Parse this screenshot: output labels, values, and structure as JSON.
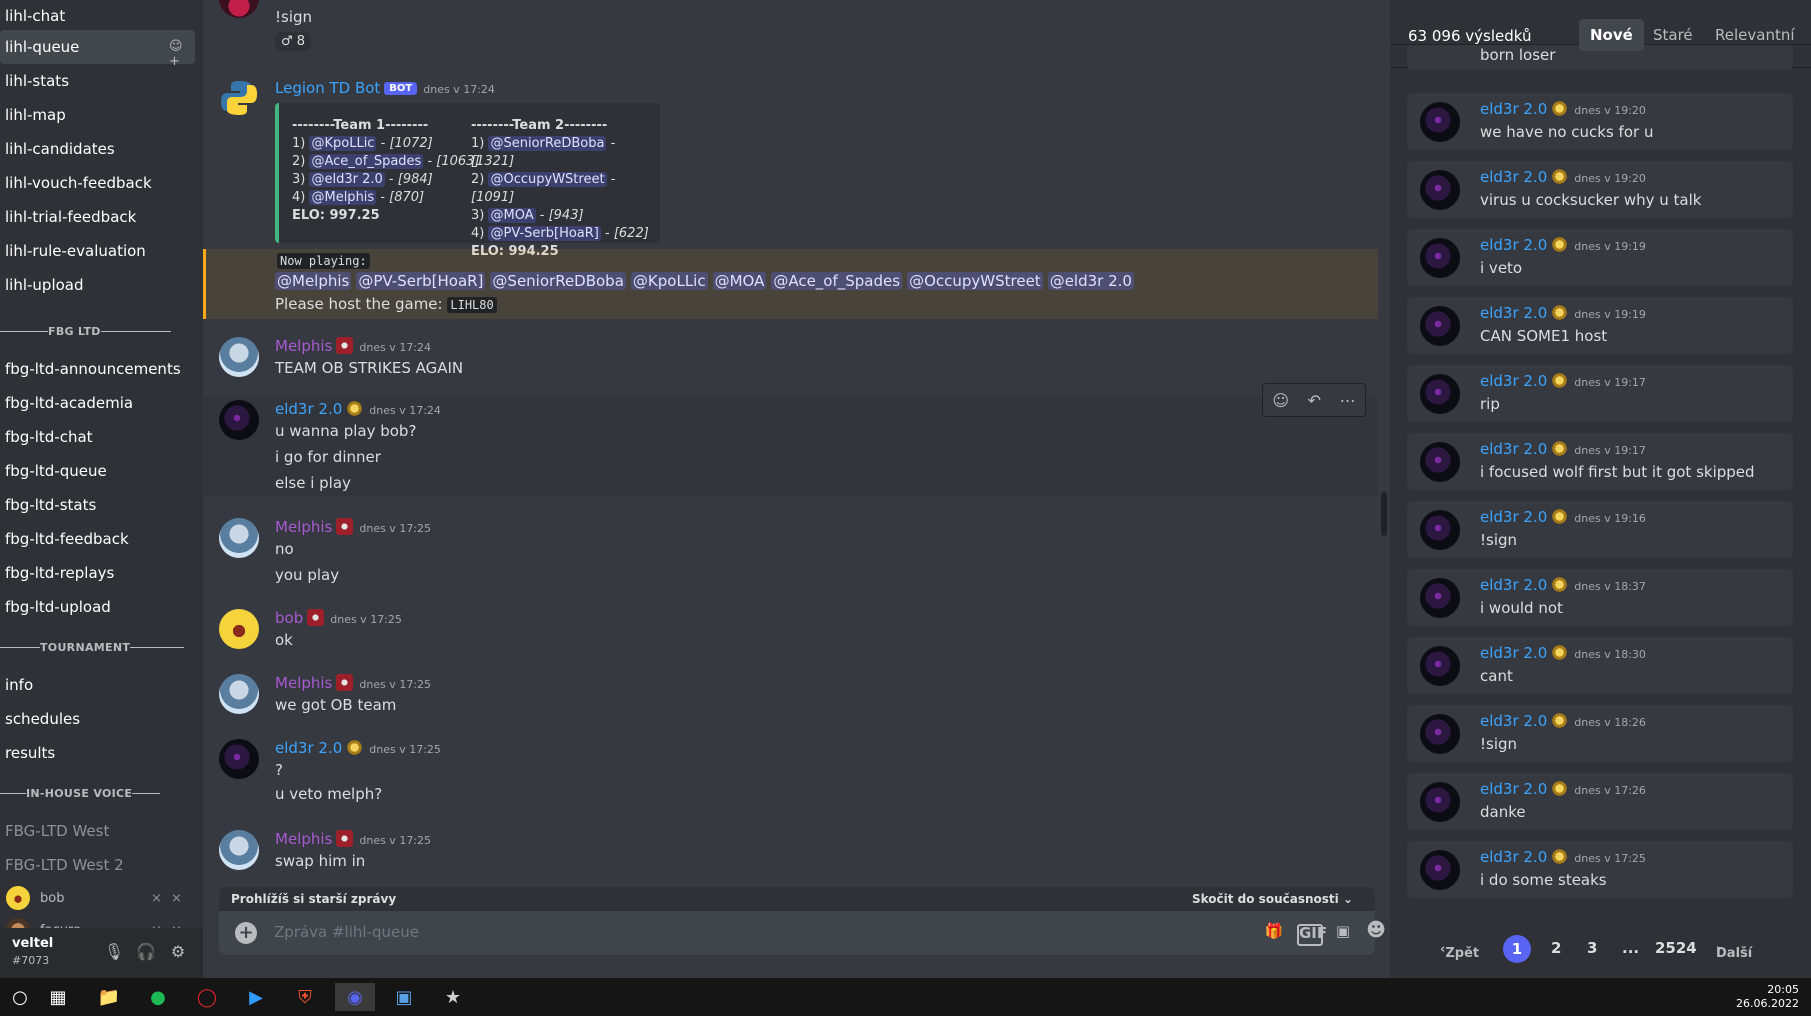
{
  "sidebar": {
    "channels_top": [
      "lihl-chat",
      "lihl-queue",
      "lihl-stats",
      "lihl-map",
      "lihl-candidates",
      "lihl-vouch-feedback",
      "lihl-trial-feedback",
      "lihl-rule-evaluation",
      "lihl-upload"
    ],
    "active_channel": "lihl-queue",
    "cat_fbg": "FBG LTD",
    "channels_fbg": [
      "fbg-ltd-announcements",
      "fbg-ltd-academia",
      "fbg-ltd-chat",
      "fbg-ltd-queue",
      "fbg-ltd-stats",
      "fbg-ltd-feedback",
      "fbg-ltd-replays",
      "fbg-ltd-upload"
    ],
    "cat_tournament": "TOURNAMENT",
    "channels_tournament": [
      "info",
      "schedules",
      "results"
    ],
    "cat_voice": "IN-HOUSE VOICE",
    "voice_channels": [
      "FBG-LTD West",
      "FBG-LTD West 2"
    ],
    "voice_users": [
      "bob",
      "facure"
    ]
  },
  "userbar": {
    "username": "veltel",
    "tag": "#7073"
  },
  "chat": {
    "top_line": "!sign",
    "reaction_count": "8",
    "bot": {
      "name": "Legion TD Bot",
      "tag": "BOT",
      "time": "dnes v 17:24",
      "team1_title": "--------Team 1--------",
      "team2_title": "--------Team 2--------",
      "team1": [
        {
          "n": "1)",
          "name": "@KpoLLic",
          "elo": "[1072]"
        },
        {
          "n": "2)",
          "name": "@Ace_of_Spades",
          "elo": "[1063]"
        },
        {
          "n": "3)",
          "name": "@eld3r 2.0",
          "elo": "[984]"
        },
        {
          "n": "4)",
          "name": "@Melphis",
          "elo": "[870]"
        }
      ],
      "team2": [
        {
          "n": "1)",
          "name": "@SeniorReDBoba",
          "elo": "[1321]"
        },
        {
          "n": "2)",
          "name": "@OccupyWStreet",
          "elo": "[1091]"
        },
        {
          "n": "3)",
          "name": "@MOA",
          "elo": "[943]"
        },
        {
          "n": "4)",
          "name": "@PV-Serb[HoaR]",
          "elo": "[622]"
        }
      ],
      "team1_elo": "ELO: 997.25",
      "team2_elo": "ELO: 994.25",
      "now_playing": "Now playing:",
      "mentions": [
        "@Melphis",
        "@PV-Serb[HoaR]",
        "@SeniorReDBoba",
        "@KpoLLic",
        "@MOA",
        "@Ace_of_Spades",
        "@OccupyWStreet",
        "@eld3r 2.0"
      ],
      "host_text": "Please host the game:",
      "host_code": "LIHL80"
    },
    "messages": [
      {
        "user": "Melphis",
        "time": "dnes v 17:24",
        "lines": [
          "TEAM OB STRIKES AGAIN"
        ]
      },
      {
        "user": "eld3r 2.0",
        "time": "dnes v 17:24",
        "lines": [
          "u wanna play bob?",
          "i go for dinner",
          "else i play"
        ]
      },
      {
        "user": "Melphis",
        "time": "dnes v 17:25",
        "lines": [
          "no",
          "you play"
        ]
      },
      {
        "user": "bob",
        "time": "dnes v 17:25",
        "lines": [
          "ok"
        ]
      },
      {
        "user": "Melphis",
        "time": "dnes v 17:25",
        "lines": [
          "we got OB team"
        ]
      },
      {
        "user": "eld3r 2.0",
        "time": "dnes v 17:25",
        "lines": [
          "?",
          "u veto melph?"
        ]
      },
      {
        "user": "Melphis",
        "time": "dnes v 17:25",
        "lines": [
          "swap him in"
        ]
      }
    ],
    "older_notice": "Prohlížíš si starší zprávy",
    "jump_present": "Skočit do současnosti",
    "composer_placeholder": "Zpráva #lihl-queue"
  },
  "search": {
    "count": "63 096 výsledků",
    "tabs": [
      "Nové",
      "Staré",
      "Relevantní"
    ],
    "active_tab": "Nové",
    "partial_top": "born loser",
    "results": [
      {
        "user": "eld3r 2.0",
        "time": "dnes v 19:20",
        "text": "we have no cucks for u"
      },
      {
        "user": "eld3r 2.0",
        "time": "dnes v 19:20",
        "text": "virus u cocksucker why u talk"
      },
      {
        "user": "eld3r 2.0",
        "time": "dnes v 19:19",
        "text": "i veto"
      },
      {
        "user": "eld3r 2.0",
        "time": "dnes v 19:19",
        "text": "CAN SOME1 host"
      },
      {
        "user": "eld3r 2.0",
        "time": "dnes v 19:17",
        "text": "rip"
      },
      {
        "user": "eld3r 2.0",
        "time": "dnes v 19:17",
        "text": "i focused wolf first but it got skipped"
      },
      {
        "user": "eld3r 2.0",
        "time": "dnes v 19:16",
        "text": "!sign"
      },
      {
        "user": "eld3r 2.0",
        "time": "dnes v 18:37",
        "text": "i would not"
      },
      {
        "user": "eld3r 2.0",
        "time": "dnes v 18:30",
        "text": "cant"
      },
      {
        "user": "eld3r 2.0",
        "time": "dnes v 18:26",
        "text": "!sign"
      },
      {
        "user": "eld3r 2.0",
        "time": "dnes v 17:26",
        "text": "danke"
      },
      {
        "user": "eld3r 2.0",
        "time": "dnes v 17:25",
        "text": "i do some steaks"
      }
    ],
    "pager": {
      "prev": "Zpět",
      "pages": [
        "1",
        "2",
        "3",
        "...",
        "2524"
      ],
      "next": "Další"
    }
  },
  "taskbar": {
    "time": "20:05",
    "date": "26.06.2022"
  }
}
